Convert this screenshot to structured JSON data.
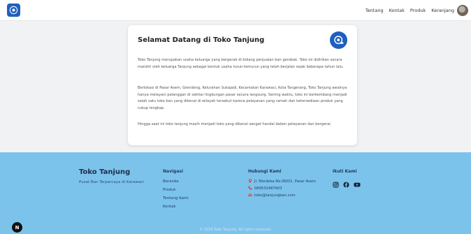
{
  "navbar": {
    "links": [
      "Tentang",
      "Kontak",
      "Produk",
      "Keranjang"
    ]
  },
  "card": {
    "title": "Selamat Datang di Toko Tanjung",
    "paragraphs": [
      "Toko Tanjung merupakan usaha keluarga yang bergerak di bidang penjualan ban gerobak. Toko ini didirikan secara mandiri oleh keluarga Tanjung sebagai bentuk usaha turun-temurun yang telah berjalan sejak beberapa tahun lalu.",
      "Berlokasi di Pasar Asem, Grendeng, Kelurahan Sukajadi, Kecamatan Karawaci, Kota Tangerang, Toko Tanjung awalnya hanya melayani pelanggan di sekitar lingkungan pasar secara langsung. Seiring waktu, toko ini berkembang menjadi salah satu toko ban yang dikenal di wilayah tersebut karena pelayanan yang ramah dan ketersediaan produk yang cukup lengkap.",
      "Hingga saat ini toko tanjung masih menjadi toko yang dikenal sangat handal dalam pelayanan dan bergerai."
    ]
  },
  "footer": {
    "brand": "Toko Tanjung",
    "tagline": "Pusat Ban Terpercaya di Karawaci",
    "nav_title": "Navigasi",
    "nav_items": [
      "Beranda",
      "Produk",
      "Tentang Kami",
      "Kontak"
    ],
    "contact_title": "Hubungi Kami",
    "contact": {
      "address": "Jl. Merdeka No.06/D1, Pasar Asem",
      "phone": "089532487603",
      "email": "toko@tanjungban.com"
    },
    "social_title": "Ikuti Kami",
    "copyright": "© 2025 Toko Tanjung. All rights reserved."
  },
  "colors": {
    "brand_blue": "#1f5fbf",
    "footer_bg": "#7cc3ec",
    "contact_icon_red": "#d23a3a"
  },
  "icons": [
    "logo-icon",
    "avatar",
    "instagram-icon",
    "facebook-icon",
    "youtube-icon",
    "map-pin-icon",
    "phone-icon",
    "mail-icon"
  ],
  "floating_badge": "N"
}
